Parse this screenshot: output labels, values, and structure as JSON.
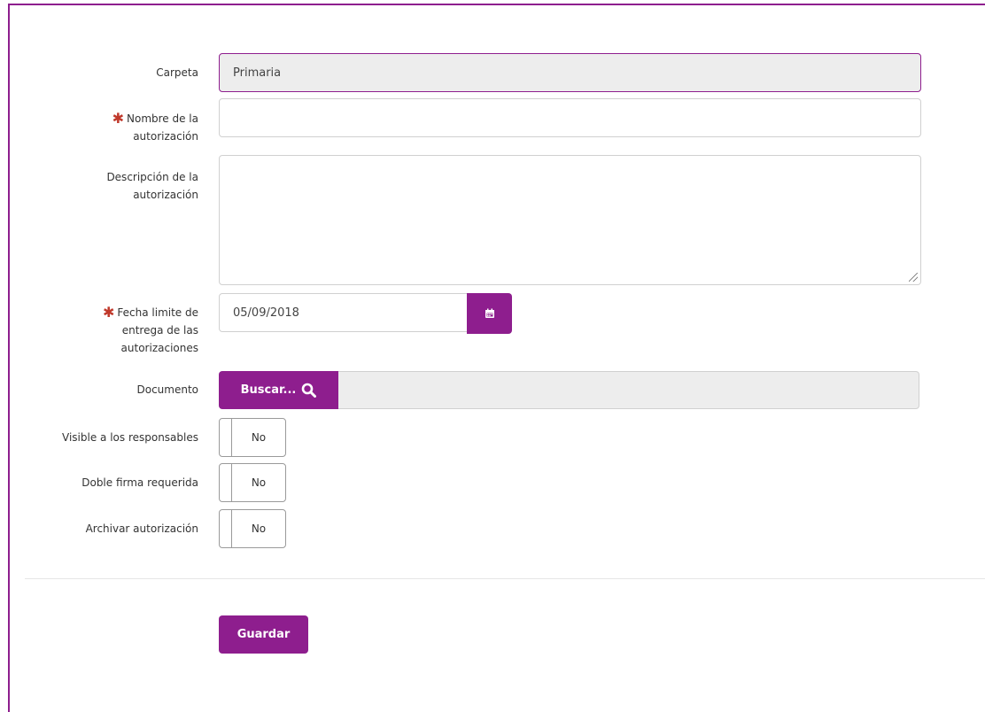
{
  "form": {
    "carpeta": {
      "label": "Carpeta",
      "value": "Primaria"
    },
    "nombre": {
      "label_line1": "Nombre de la",
      "label_line2": "autorización",
      "value": ""
    },
    "descripcion": {
      "label_line1": "Descripción de la",
      "label_line2": "autorización",
      "value": ""
    },
    "fecha": {
      "label_line1": "Fecha limite de",
      "label_line2": "entrega de las",
      "label_line3": "autorizaciones",
      "value": "05/09/2018"
    },
    "documento": {
      "label": "Documento",
      "button_label": "Buscar...",
      "value": ""
    },
    "visible": {
      "label": "Visible a los responsables",
      "state": "No"
    },
    "doble_firma": {
      "label": "Doble firma requerida",
      "state": "No"
    },
    "archivar": {
      "label": "Archivar autorización",
      "state": "No"
    },
    "required_mark": "✱",
    "save_label": "Guardar"
  },
  "icons": {
    "calendar": "calendar-icon",
    "search": "search-icon"
  },
  "colors": {
    "accent": "#8e1e8e",
    "required": "#c0392b",
    "readonly_bg": "#ededed"
  }
}
